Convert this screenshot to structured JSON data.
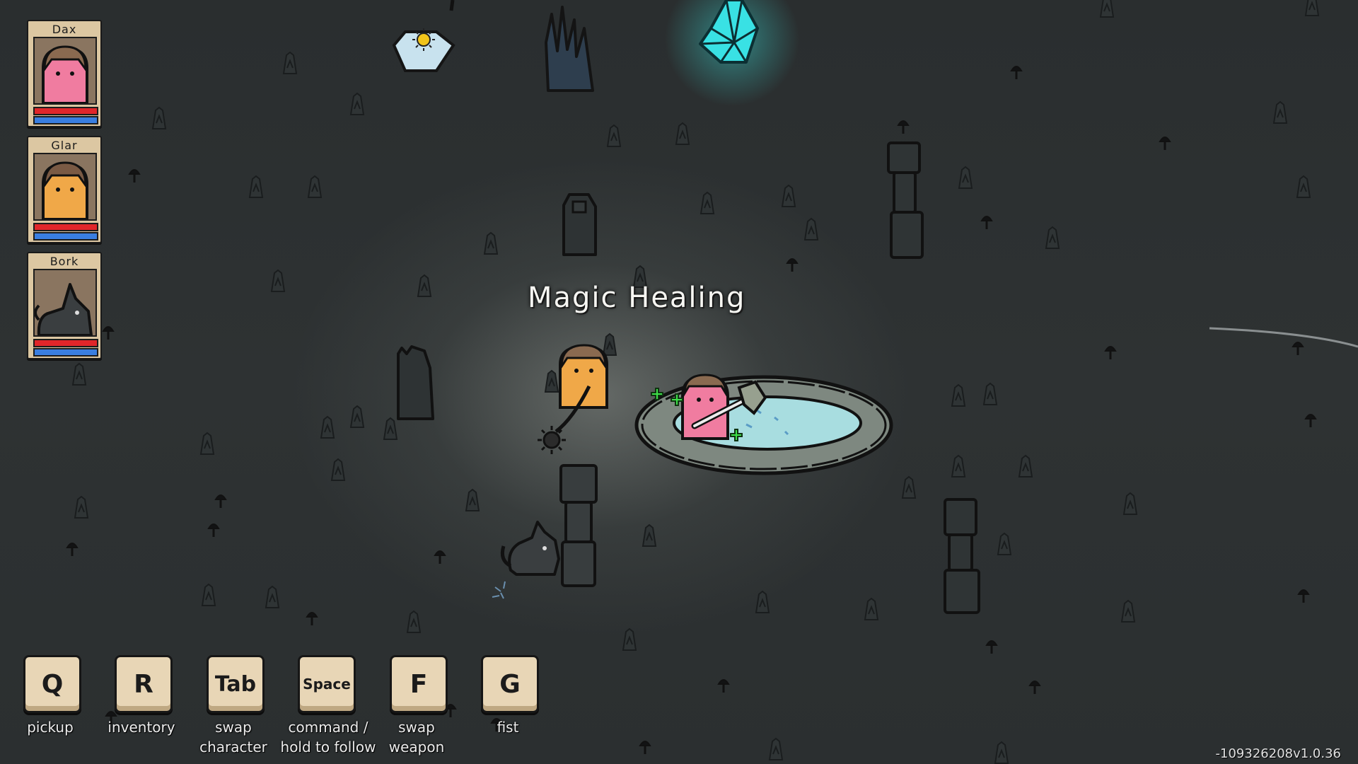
{
  "party": [
    {
      "name": "Dax",
      "kind": "human-pink",
      "hp": 1.0,
      "mana": 1.0
    },
    {
      "name": "Glar",
      "kind": "human-tan",
      "hp": 1.0,
      "mana": 1.0
    },
    {
      "name": "Bork",
      "kind": "wolf-dog",
      "hp": 1.0,
      "mana": 1.0
    }
  ],
  "world": {
    "floating_text": "Magic Healing",
    "objects": [
      "sun-totem-icon",
      "dark-grass-icon",
      "glowing-crystal-icon",
      "healing-pool",
      "stone-pillar",
      "stone-stack",
      "mushroom-icon"
    ]
  },
  "hotkeys": [
    {
      "key": "Q",
      "label": "pickup"
    },
    {
      "key": "R",
      "label": "inventory"
    },
    {
      "key": "Tab",
      "label": "swap\ncharacter"
    },
    {
      "key": "Space",
      "label": "command /\nhold to follow"
    },
    {
      "key": "F",
      "label": "swap\nweapon"
    },
    {
      "key": "G",
      "label": "fist"
    }
  ],
  "version": "-109326208v1.0.36",
  "colors": {
    "health": "#e0262a",
    "mana": "#3a7ee0",
    "card": "#dcc7a2",
    "crystal": "#3ee6e6",
    "pool": "#9fd8dc"
  }
}
